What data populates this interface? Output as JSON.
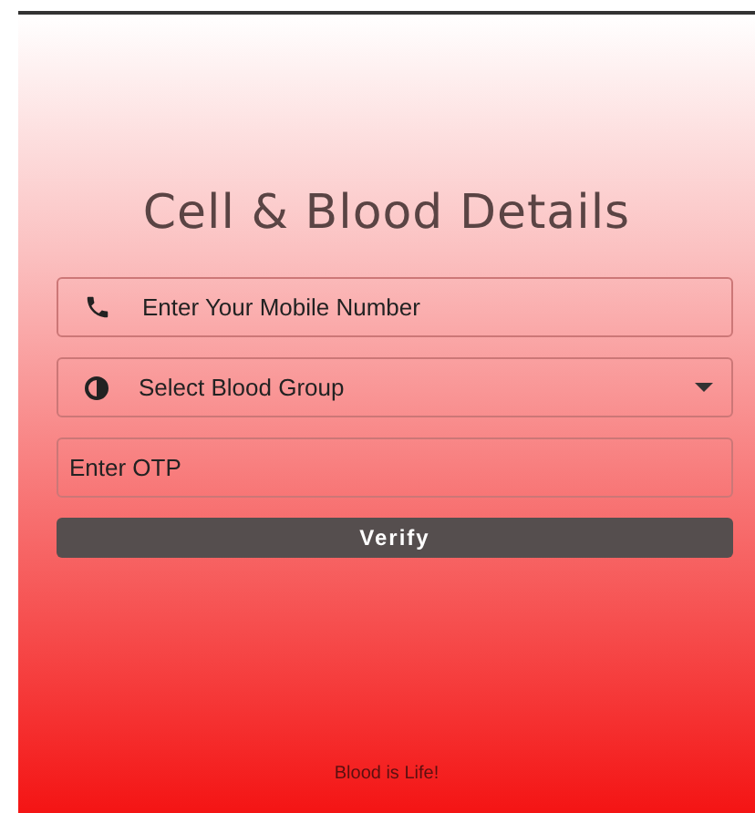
{
  "title": "Cell & Blood Details",
  "fields": [
    {
      "kind": "phone",
      "placeholder": "Enter Your Mobile Number"
    },
    {
      "kind": "select",
      "placeholder": "Select Blood Group"
    },
    {
      "kind": "plain",
      "placeholder": "Enter OTP"
    }
  ],
  "button": "Verify",
  "footer": "Blood is Life!"
}
